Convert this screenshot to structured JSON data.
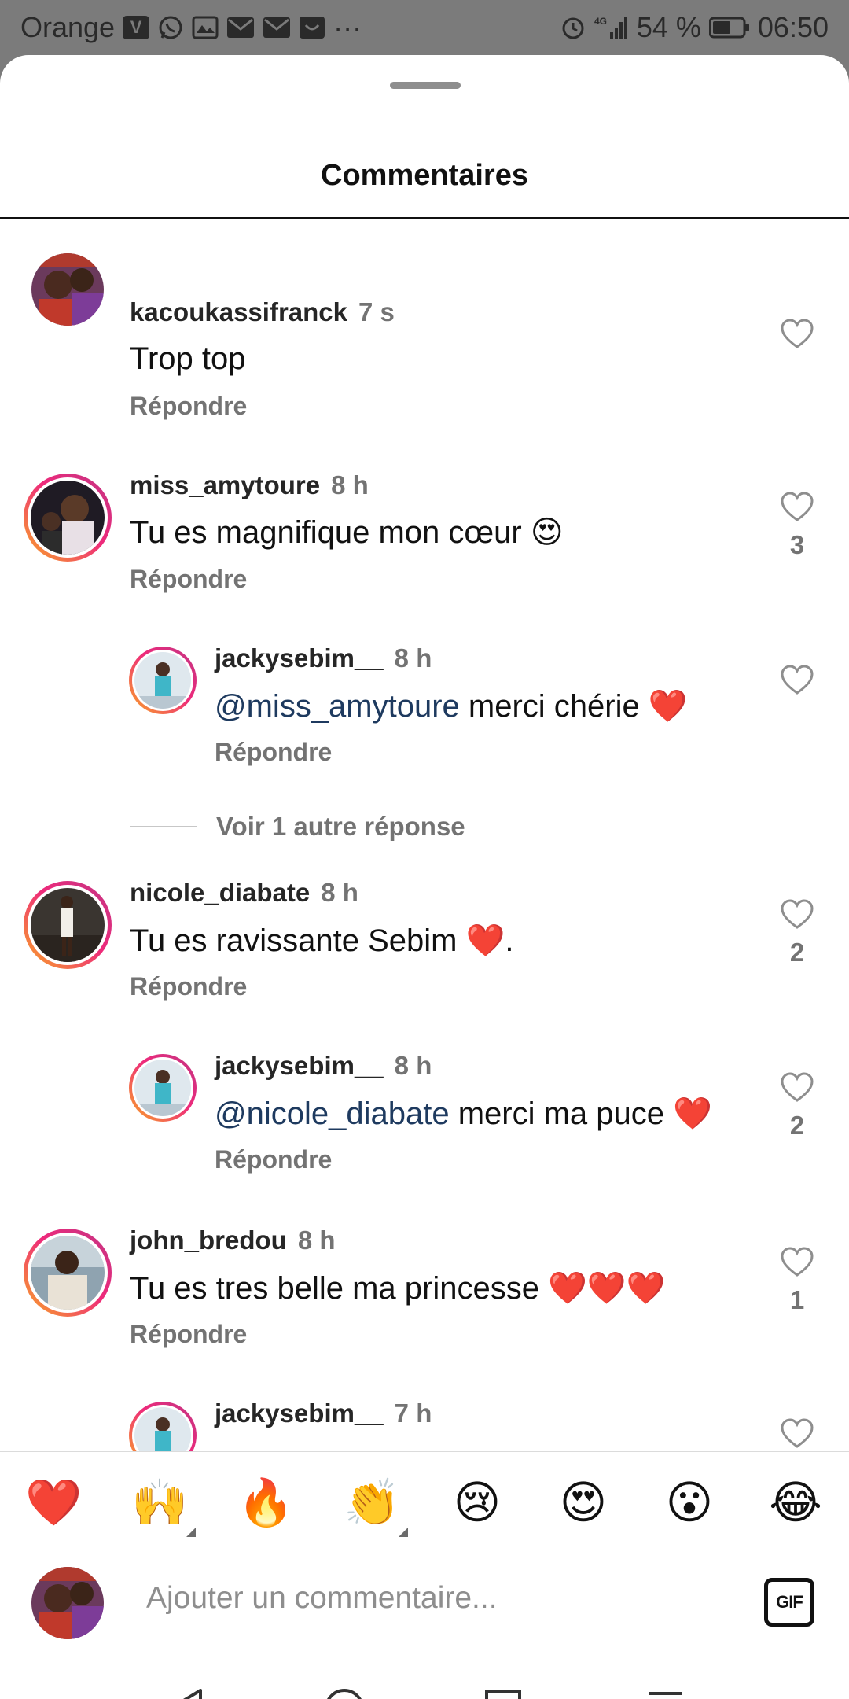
{
  "status_bar": {
    "carrier": "Orange",
    "more_indicator": "···",
    "network": "4G",
    "battery": "54 %",
    "time": "06:50",
    "icons": [
      "viber-icon",
      "whatsapp-icon",
      "gallery-icon",
      "mail-icon",
      "mail-icon",
      "notification-icon",
      "alarm-icon",
      "signal-icon",
      "battery-icon"
    ]
  },
  "sheet": {
    "title": "Commentaires"
  },
  "comments": [
    {
      "username": "kacoukassifranck",
      "time": "7 s",
      "text": "Trop top",
      "reply": "Répondre",
      "likes": ""
    },
    {
      "username": "miss_amytoure",
      "time": "8 h",
      "text": "Tu es magnifique mon cœur 😍",
      "reply": "Répondre",
      "likes": "3"
    },
    {
      "username": "jackysebim__",
      "time": "8 h",
      "mention": "@miss_amytoure",
      "text": " merci chérie ❤️",
      "reply": "Répondre",
      "likes": ""
    },
    {
      "username": "nicole_diabate",
      "time": "8 h",
      "text": "Tu es ravissante Sebim ❤️.",
      "reply": "Répondre",
      "likes": "2"
    },
    {
      "username": "jackysebim__",
      "time": "8 h",
      "mention": "@nicole_diabate",
      "text": " merci ma puce ❤️",
      "reply": "Répondre",
      "likes": "2"
    },
    {
      "username": "john_bredou",
      "time": "8 h",
      "text": "Tu es tres belle ma princesse ❤️❤️❤️",
      "reply": "Répondre",
      "likes": "1"
    },
    {
      "username": "jackysebim__",
      "time": "7 h",
      "text": "",
      "reply": "",
      "likes": ""
    }
  ],
  "view_more": "Voir 1 autre réponse",
  "emoji_bar": [
    "❤️",
    "🙌",
    "🔥",
    "👏",
    "😢",
    "😍",
    "😮",
    "😂"
  ],
  "composer": {
    "placeholder": "Ajouter un commentaire...",
    "gif_label": "GIF"
  },
  "colors": {
    "accent_ring_start": "#f9a825",
    "accent_ring_end": "#c13584",
    "mention": "#1e3a5f",
    "muted": "#737373"
  }
}
